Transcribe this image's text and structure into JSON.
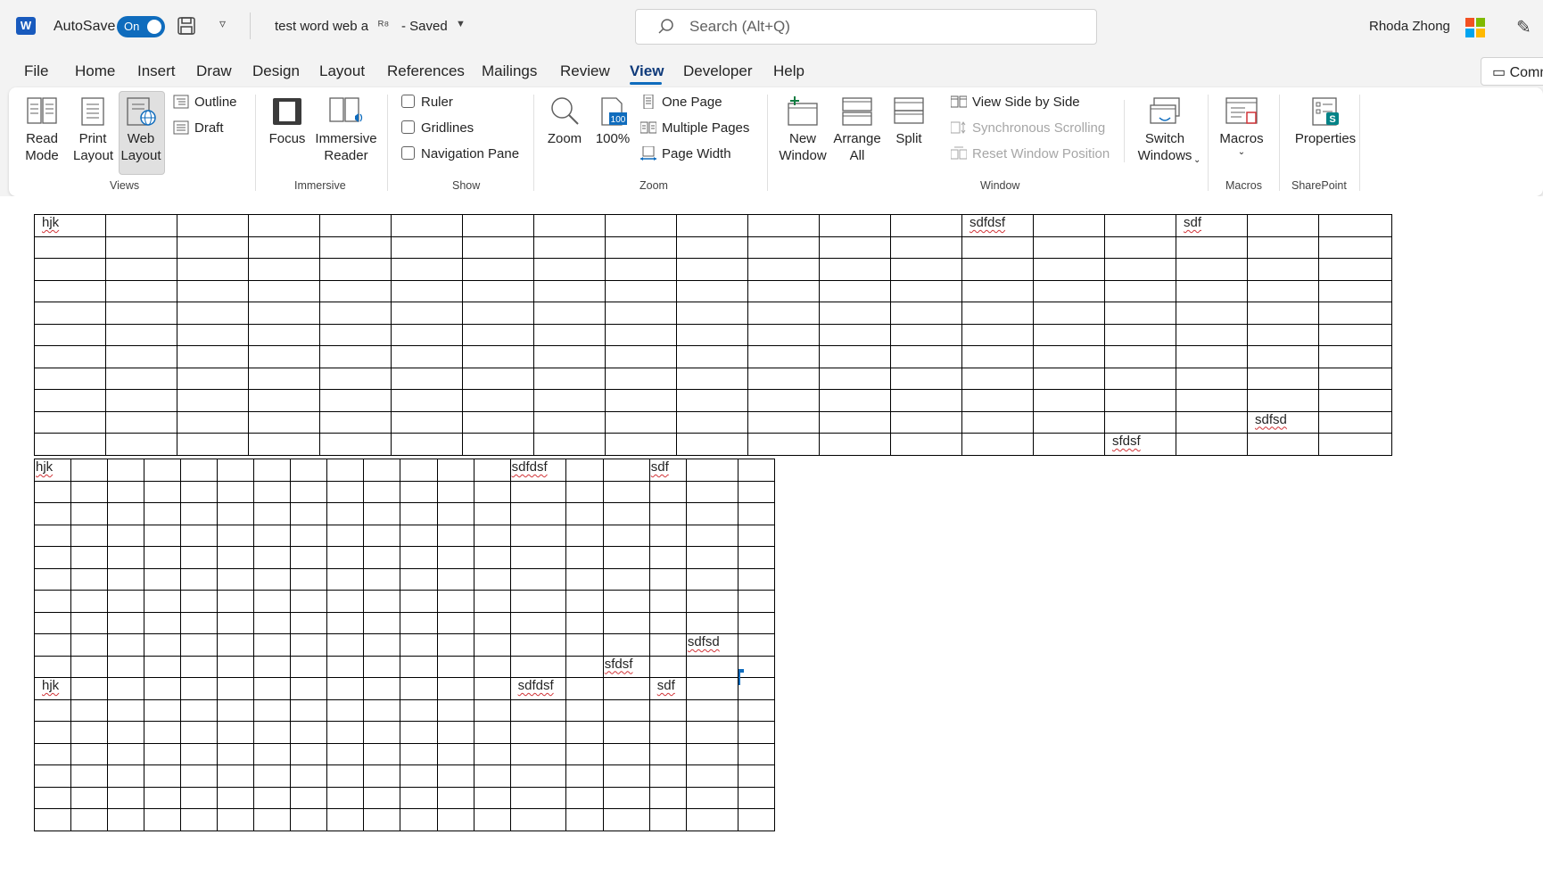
{
  "titlebar": {
    "autosave_label": "AutoSave",
    "toggle_label": "On",
    "document_title": "test word web a",
    "saved_status": "- Saved",
    "search_placeholder": "Search (Alt+Q)",
    "user_name": "Rhoda Zhong"
  },
  "tabs": [
    "File",
    "Home",
    "Insert",
    "Draw",
    "Design",
    "Layout",
    "References",
    "Mailings",
    "Review",
    "View",
    "Developer",
    "Help"
  ],
  "active_tab": "View",
  "comments_label": "Comm",
  "ribbon": {
    "views": {
      "read_mode": "Read\nMode",
      "print_layout": "Print\nLayout",
      "web_layout": "Web\nLayout",
      "outline": "Outline",
      "draft": "Draft",
      "label": "Views"
    },
    "immersive": {
      "focus": "Focus",
      "immersive_reader": "Immersive\nReader",
      "label": "Immersive"
    },
    "show": {
      "ruler": "Ruler",
      "gridlines": "Gridlines",
      "navigation_pane": "Navigation Pane",
      "label": "Show"
    },
    "zoom": {
      "zoom": "Zoom",
      "hundred": "100%",
      "hundred_badge": "100",
      "one_page": "One Page",
      "multiple_pages": "Multiple Pages",
      "page_width": "Page Width",
      "label": "Zoom"
    },
    "window": {
      "new_window": "New\nWindow",
      "arrange_all": "Arrange\nAll",
      "split": "Split",
      "view_side_by_side": "View Side by Side",
      "synchronous_scrolling": "Synchronous Scrolling",
      "reset_window_position": "Reset Window Position",
      "switch_windows": "Switch\nWindows",
      "label": "Window"
    },
    "macros": {
      "macros": "Macros",
      "label": "Macros"
    },
    "sharepoint": {
      "properties": "Properties",
      "label": "SharePoint"
    }
  },
  "document": {
    "words": {
      "hjk": "hjk",
      "sdfdsf": "sdfdsf",
      "sdf": "sdf",
      "sdfsd": "sdfsd",
      "sfdsf": "sfdsf"
    }
  },
  "colors": {
    "accent": "#0f6cbd",
    "word_blue": "#185abd",
    "spell_underline": "#d13438"
  }
}
